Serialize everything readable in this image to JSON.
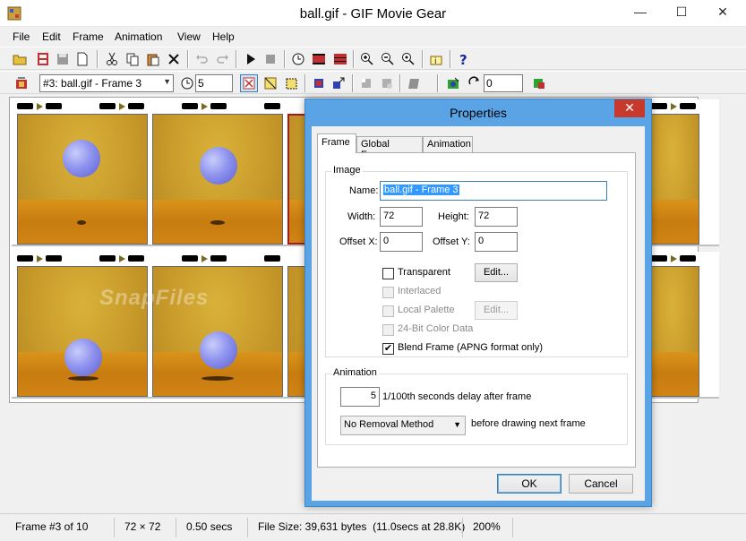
{
  "window": {
    "title": "ball.gif - GIF Movie Gear",
    "min_glyph": "—",
    "max_glyph": "☐",
    "close_glyph": "✕"
  },
  "menu": [
    "File",
    "Edit",
    "Frame",
    "Animation",
    "View",
    "Help"
  ],
  "toolbar2": {
    "frame_select": "#3: ball.gif - Frame 3",
    "delay_value": "5",
    "loop_value": "0"
  },
  "filmstrip": {
    "watermark": "SnapFiles"
  },
  "status": {
    "frame": "Frame #3 of 10",
    "size": "72 × 72",
    "duration": "0.50 secs",
    "filesize": "File Size: 39,631 bytes  (11.0secs at 28.8K)",
    "zoom": "200%"
  },
  "dialog": {
    "title": "Properties",
    "close_glyph": "✕",
    "tabs": [
      "Frame",
      "Global Frame",
      "Animation"
    ],
    "image_group": {
      "title": "Image",
      "name_label": "Name:",
      "name_value": "ball.gif - Frame 3",
      "width_label": "Width:",
      "width_value": "72",
      "height_label": "Height:",
      "height_value": "72",
      "offsetx_label": "Offset X:",
      "offsetx_value": "0",
      "offsety_label": "Offset Y:",
      "offsety_value": "0",
      "transparent": "Transparent",
      "interlaced": "Interlaced",
      "local_palette": "Local Palette",
      "color24": "24-Bit Color Data",
      "blend": "Blend Frame (APNG format only)",
      "edit_label": "Edit...",
      "check_mark": "✔"
    },
    "animation_group": {
      "title": "Animation",
      "delay_value": "5",
      "delay_label": "1/100th seconds delay after frame",
      "removal_value": "No Removal Method",
      "removal_label": "before drawing next frame"
    },
    "ok_label": "OK",
    "cancel_label": "Cancel"
  }
}
